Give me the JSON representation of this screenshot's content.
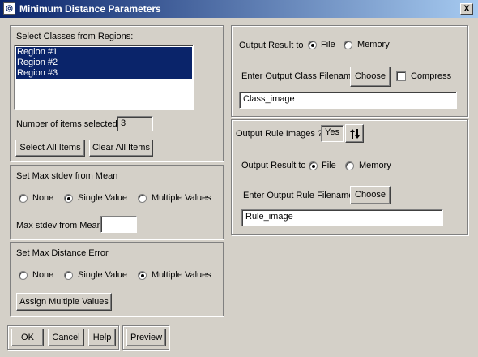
{
  "window": {
    "title": "Minimum Distance Parameters",
    "close_label": "X"
  },
  "classes": {
    "heading": "Select Classes from Regions:",
    "items": [
      "Region #1",
      "Region #2",
      "Region #3"
    ],
    "count_label": "Number of items selected:",
    "count_value": "3",
    "select_all_label": "Select All Items",
    "clear_all_label": "Clear All Items"
  },
  "stdev": {
    "heading": "Set Max stdev from Mean",
    "options": [
      "None",
      "Single Value",
      "Multiple Values"
    ],
    "selected": "Single Value",
    "field_label": "Max stdev from Mean",
    "field_value": ""
  },
  "distance_error": {
    "heading": "Set Max Distance Error",
    "options": [
      "None",
      "Single Value",
      "Multiple Values"
    ],
    "selected": "Multiple Values",
    "assign_label": "Assign Multiple Values"
  },
  "output": {
    "result_label": "Output Result to",
    "file_label": "File",
    "memory_label": "Memory",
    "selected": "File",
    "filename_label": "Enter Output Class Filename",
    "choose_label": "Choose",
    "compress_label": "Compress",
    "compress_checked": false,
    "filename_value": "Class_image"
  },
  "rule": {
    "images_label": "Output Rule Images ?",
    "images_value": "Yes",
    "toggle_icon": "up-down-arrows-icon",
    "result_label": "Output Result to",
    "file_label": "File",
    "memory_label": "Memory",
    "selected": "File",
    "filename_label": "Enter Output Rule Filename",
    "choose_label": "Choose",
    "filename_value": "Rule_image"
  },
  "footer": {
    "ok_label": "OK",
    "cancel_label": "Cancel",
    "help_label": "Help",
    "preview_label": "Preview"
  }
}
